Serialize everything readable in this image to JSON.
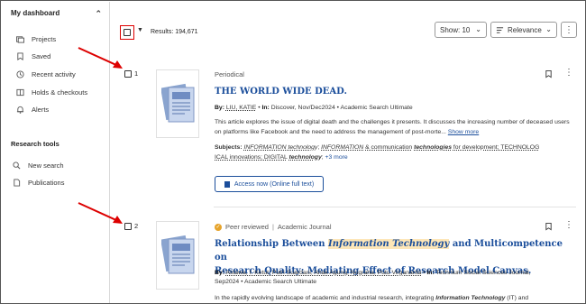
{
  "sidebar": {
    "header": "My dashboard",
    "items": [
      {
        "label": "Projects",
        "icon": "folders-icon"
      },
      {
        "label": "Saved",
        "icon": "bookmark-icon"
      },
      {
        "label": "Recent activity",
        "icon": "history-icon"
      },
      {
        "label": "Holds & checkouts",
        "icon": "book-icon"
      },
      {
        "label": "Alerts",
        "icon": "bell-icon"
      }
    ],
    "section_title": "Research tools",
    "tools": [
      {
        "label": "New search",
        "icon": "search-icon"
      },
      {
        "label": "Publications",
        "icon": "document-icon"
      }
    ]
  },
  "toolbar": {
    "results": "Results: 194,671",
    "show_label": "Show: 10",
    "sort_label": "Relevance"
  },
  "results": [
    {
      "num": "1",
      "type": "Periodical",
      "title": "THE WORLD WIDE DEAD.",
      "by_label": "By:",
      "authors": "LIU, KATIE",
      "in_label": "In:",
      "source": "Discover, Nov/Dec2024",
      "database": "Academic Search Ultimate",
      "abstract": "This article explores the issue of digital death and the challenges it presents. It discusses the increasing number of deceased users on platforms like Facebook and the need to address the management of post-morte...",
      "show_more": "Show more",
      "subjects_label": "Subjects:",
      "subjects_line1_a": "INFORMATION technology",
      "subjects_line1_b": "INFORMATION",
      "subjects_line1_c": "& communication",
      "subjects_line1_d": "technologies",
      "subjects_line1_e": "for development; TECHNOLOG",
      "subjects_line2_a": "ICAL innovations; DIGITAL",
      "subjects_line2_b": "technology",
      "subjects_more": "+3 more",
      "access_label": "Access now (Online full text)"
    },
    {
      "num": "2",
      "peer": "Peer reviewed",
      "type": "Academic Journal",
      "title_a": "Relationship Between",
      "title_hl": "Information Technology",
      "title_b": "and Multicompetence on",
      "title_line2": "Research Quality: Mediating Effect of Research Model Canvas.",
      "by_label": "By:",
      "authors": "Astawa, I. Ketut; Putri Suardani, Anak Agung; Nugraha, Putu Virgananta",
      "in_label": "In:",
      "source": "Technium Social Sciences Journal,",
      "source2": "Sep2024",
      "database": "Academic Search Ultimate",
      "abstract_a": "In the rapidly evolving landscape of academic and industrial research, integrating",
      "abstract_hl": "Information Technology",
      "abstract_b": "(IT) and"
    }
  ],
  "colors": {
    "link": "#1b4e9b",
    "highlight": "#fde6b8",
    "annotation": "#dd0000"
  }
}
